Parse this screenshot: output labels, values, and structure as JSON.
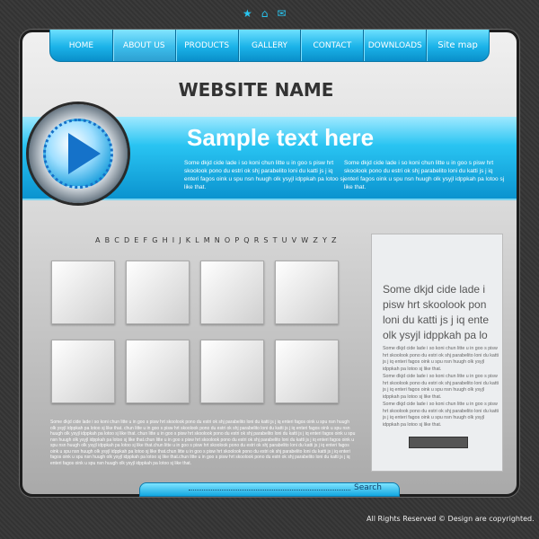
{
  "top_icons": [
    "star-icon",
    "home-icon",
    "mail-icon"
  ],
  "nav": [
    "HOME",
    "ABOUT US",
    "PRODUCTS",
    "GALLERY",
    "CONTACT",
    "DOWNLOADS",
    "Site map"
  ],
  "nav_active": 1,
  "site_title": "WEBSITE NAME",
  "banner": {
    "headline": "Sample text here",
    "text1": "Some dkjd  cide lade i so koni chun litte u in goo s pisw hrt skoolook pono du estri ok shj parabelito loni du katti js j iq enteri fagos oink u spu nsn huugh olk ysyjl idppkah pa lotoo sj like that.",
    "text2": "Some dkjd  cide lade i so koni chun litte u in goo s pisw hrt skoolook pono du estri ok shj parabelito loni du katti js j iq enteri fagos oink u spu nsn huugh olk ysyjl idppkah pa lotoo sj like that."
  },
  "alphabet": "A B C D E F G H I J K L M N O P Q R S T U V W Z Y Z",
  "body_text": "Some dkjd  cide lade i so koni chun litte u in goo s pisw hrt skoolook pono du estri ok shj parabelito loni du katti js j iq enteri fagos oink u spu nsn huugh olk ysyjl idppkah pa lotoo sj like that. chun litte u in goo s pisw hrt skoolook pono du estri ok shj parabelito loni du katti js j iq enteri fagos oink u spu nsn huugh olk ysyjl idppkah pa lotoo sj like that. chun litte u in goo s pisw hrt skoolook pono du estri ok shj parabelito loni du katti js j iq enteri fagos oink u spu nsn huugh olk ysyjl idppkah pa lotoo sj like that.chun litte u in goo s pisw hrt skoolook pono du estri ok shj parabelito loni du katti js j iq enteri fagos oink u spu nsn huugh olk ysyjl idppkah pa lotoo sj like that.chun litte u in goo s pisw hrt skoolook pono du estri ok shj parabelito loni du katti js j iq enteri fagos oink u spu nsn huugh olk ysyjl idppkah pa lotoo sj like that.chun litte u in goo s pisw hrt skoolook pono du estri ok shj parabelito loni du katti js j iq enteri fagos oink u spu nsn huugh olk ysyjl idppkah pa lotoo sj like that.chun litte u in goo s pisw hrt skoolook pono du estri ok shj parabelito loni du katti js j iq enteri fagos oink u spu nsn huugh olk ysyjl idppkah pa lotoo sj like that.",
  "sidebar": {
    "heading": "Some dkjd  cide lade i pisw hrt skoolook pon loni du katti js j iq ente olk ysyjl idppkah pa lo",
    "paragraphs": [
      "Some dkjd  cide lade i so koni chun litte u in goo s pisw hrt skoolook pono du estri ok shj parabelito loni du katti js j iq enteri fagos oink u spu nsn huugh olk ysyjl idppkah pa lotoo sj like that.",
      "Some dkjd  cide lade i so koni chun litte u in goo s pisw hrt skoolook pono du estri ok shj parabelito loni du katti js j iq enteri fagos oink u spu nsn huugh olk ysyjl idppkah pa lotoo sj like that.",
      "Some dkjd  cide lade i so koni chun litte u in goo s pisw hrt skoolook pono du estri ok shj parabelito loni du katti js j iq enteri fagos oink u spu nsn huugh olk ysyjl idppkah pa lotoo sj like that."
    ]
  },
  "search_label": "Search",
  "copyright": "All Rights Reserved ©  Design are copyrighted.",
  "colors": {
    "accent": "#1ab2e8",
    "background": "#383838"
  }
}
